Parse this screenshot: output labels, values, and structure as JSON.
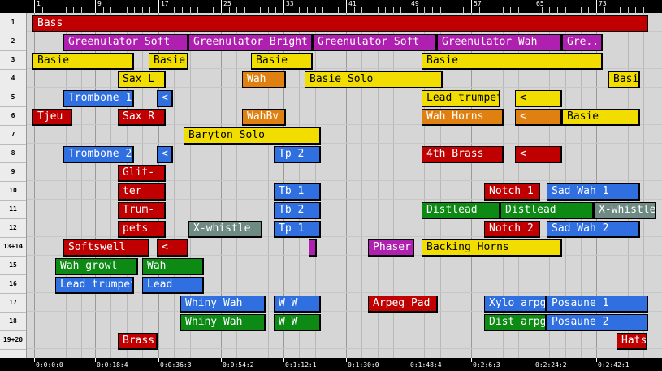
{
  "ruler": {
    "bars": [
      "1",
      "9",
      "17",
      "25",
      "33",
      "41",
      "49",
      "57",
      "65",
      "73"
    ]
  },
  "time": {
    "labels": [
      "0:0:0:0",
      "0:0:18:4",
      "0:0:36:3",
      "0:0:54:2",
      "0:1:12:1",
      "0:1:30:0",
      "0:1:48:4",
      "0:2:6:3",
      "0:2:24:2",
      "0:2:42:1"
    ]
  },
  "rows": [
    "1",
    "2",
    "3",
    "4",
    "5",
    "6",
    "7",
    "8",
    "9",
    "10",
    "11",
    "12",
    "13+14",
    "15",
    "16",
    "17",
    "18",
    "19+20"
  ],
  "colors": {
    "red": "#c00000",
    "magenta": "#b020b0",
    "yellow": "#f2dd00",
    "orange": "#e08010",
    "blue": "#2f6fe0",
    "green": "#0c8a14",
    "gray": "#6e8a82",
    "white_text": "#ffffff",
    "dark_text": "#000000"
  },
  "clips": [
    {
      "label": "Bass",
      "row": 0,
      "c": "red"
    },
    {
      "label": "Greenulator Soft",
      "row": 1,
      "c": "magenta"
    },
    {
      "label": "Greenulator Bright",
      "row": 1,
      "c": "magenta"
    },
    {
      "label": "Greenulator Soft",
      "row": 1,
      "c": "magenta"
    },
    {
      "label": "Greenulator Wah",
      "row": 1,
      "c": "magenta"
    },
    {
      "label": "Gre..",
      "row": 1,
      "c": "magenta"
    },
    {
      "label": "Basie",
      "row": 2,
      "c": "yellow"
    },
    {
      "label": "Basie",
      "row": 2,
      "c": "yellow"
    },
    {
      "label": "Basie",
      "row": 2,
      "c": "yellow"
    },
    {
      "label": "Basie",
      "row": 2,
      "c": "yellow"
    },
    {
      "label": "Sax L",
      "row": 3,
      "c": "yellow"
    },
    {
      "label": "Wah",
      "row": 3,
      "c": "orange"
    },
    {
      "label": "Basie Solo",
      "row": 3,
      "c": "yellow"
    },
    {
      "label": "Basie",
      "row": 3,
      "c": "yellow"
    },
    {
      "label": "Trombone 1",
      "row": 4,
      "c": "blue"
    },
    {
      "label": "<",
      "row": 4,
      "c": "blue"
    },
    {
      "label": "Lead trumpet",
      "row": 4,
      "c": "yellow"
    },
    {
      "label": "<",
      "row": 4,
      "c": "yellow"
    },
    {
      "label": "Tjeu",
      "row": 5,
      "c": "red"
    },
    {
      "label": "Sax R",
      "row": 5,
      "c": "red"
    },
    {
      "label": "WahBv",
      "row": 5,
      "c": "orange"
    },
    {
      "label": "Wah Horns",
      "row": 5,
      "c": "orange"
    },
    {
      "label": "<",
      "row": 5,
      "c": "orange"
    },
    {
      "label": "Basie",
      "row": 5,
      "c": "yellow"
    },
    {
      "label": "Baryton Solo",
      "row": 6,
      "c": "yellow"
    },
    {
      "label": "Trombone 2",
      "row": 7,
      "c": "blue"
    },
    {
      "label": "<",
      "row": 7,
      "c": "blue"
    },
    {
      "label": "Tp 2",
      "row": 7,
      "c": "blue"
    },
    {
      "label": "4th Brass",
      "row": 7,
      "c": "red"
    },
    {
      "label": "<",
      "row": 7,
      "c": "red"
    },
    {
      "label": "Glit-",
      "row": 8,
      "c": "red"
    },
    {
      "label": "ter",
      "row": 9,
      "c": "red"
    },
    {
      "label": "Tb 1",
      "row": 9,
      "c": "blue"
    },
    {
      "label": "Notch 1",
      "row": 9,
      "c": "red"
    },
    {
      "label": "Sad Wah 1",
      "row": 9,
      "c": "blue"
    },
    {
      "label": "Trum-",
      "row": 10,
      "c": "red"
    },
    {
      "label": "Tb 2",
      "row": 10,
      "c": "blue"
    },
    {
      "label": "Distlead",
      "row": 10,
      "c": "green"
    },
    {
      "label": "Distlead",
      "row": 10,
      "c": "green"
    },
    {
      "label": "X-whistle",
      "row": 10,
      "c": "gray"
    },
    {
      "label": "pets",
      "row": 11,
      "c": "red"
    },
    {
      "label": "X-whistle",
      "row": 11,
      "c": "gray"
    },
    {
      "label": "Tp 1",
      "row": 11,
      "c": "blue"
    },
    {
      "label": "Notch 2",
      "row": 11,
      "c": "red"
    },
    {
      "label": "Sad Wah 2",
      "row": 11,
      "c": "blue"
    },
    {
      "label": "Softswell",
      "row": 12,
      "c": "red"
    },
    {
      "label": "<",
      "row": 12,
      "c": "red"
    },
    {
      "label": "",
      "row": 12,
      "c": "magenta"
    },
    {
      "label": "Phaser",
      "row": 12,
      "c": "magenta"
    },
    {
      "label": "Backing Horns",
      "row": 12,
      "c": "yellow"
    },
    {
      "label": "Wah growl",
      "row": 13,
      "c": "green"
    },
    {
      "label": "Wah",
      "row": 13,
      "c": "green"
    },
    {
      "label": "Lead trumpet",
      "row": 14,
      "c": "blue"
    },
    {
      "label": "Lead",
      "row": 14,
      "c": "blue"
    },
    {
      "label": "Whiny Wah",
      "row": 15,
      "c": "blue"
    },
    {
      "label": "W W",
      "row": 15,
      "c": "blue"
    },
    {
      "label": "Arpeg Pad",
      "row": 15,
      "c": "red"
    },
    {
      "label": "Xylo arpg",
      "row": 15,
      "c": "blue"
    },
    {
      "label": "Posaune 1",
      "row": 15,
      "c": "blue"
    },
    {
      "label": "Whiny Wah",
      "row": 16,
      "c": "green"
    },
    {
      "label": "W W",
      "row": 16,
      "c": "green"
    },
    {
      "label": "Dist arpg",
      "row": 16,
      "c": "green"
    },
    {
      "label": "Posaune 2",
      "row": 16,
      "c": "blue"
    },
    {
      "label": "Brass",
      "row": 17,
      "c": "red"
    },
    {
      "label": "Hats",
      "row": 17,
      "c": "red"
    }
  ]
}
